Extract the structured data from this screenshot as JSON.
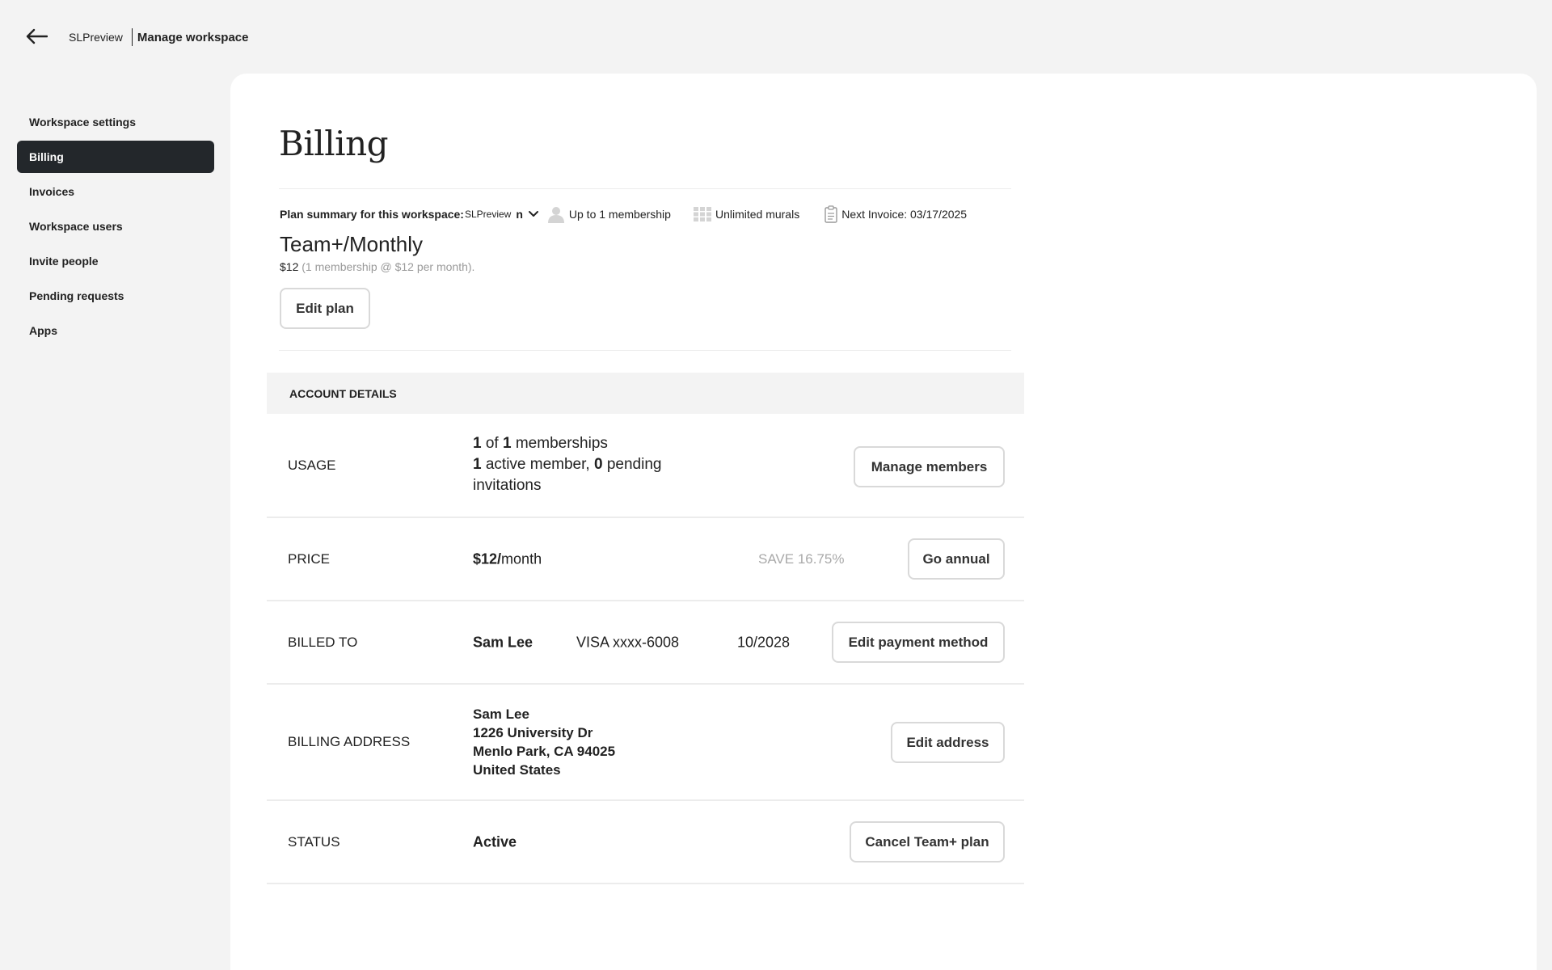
{
  "header": {
    "back_icon": "arrow-left-icon",
    "workspace_name": "SLPreview",
    "page_context": "Manage workspace"
  },
  "sidebar": {
    "items": [
      {
        "label": "Workspace settings",
        "active": false
      },
      {
        "label": "Billing",
        "active": true
      },
      {
        "label": "Invoices",
        "active": false
      },
      {
        "label": "Workspace users",
        "active": false
      },
      {
        "label": "Invite people",
        "active": false
      },
      {
        "label": "Pending requests",
        "active": false
      },
      {
        "label": "Apps",
        "active": false
      }
    ]
  },
  "billing": {
    "title": "Billing",
    "summary_label": "Plan summary for this workspace:",
    "summary_workspace": "SLPreview",
    "summary_suffix": "n",
    "members_limit": "Up to 1 membership",
    "murals": "Unlimited murals",
    "next_invoice": "Next Invoice: 03/17/2025",
    "plan_name": "Team+/Monthly",
    "plan_price": "$12",
    "plan_price_detail": "(1 membership @ $12 per month).",
    "edit_plan_label": "Edit plan"
  },
  "account_details": {
    "header": "ACCOUNT DETAILS",
    "usage": {
      "label": "USAGE",
      "memberships_used": "1",
      "memberships_of": "of",
      "memberships_total": "1",
      "memberships_word": "memberships",
      "active_count": "1",
      "active_word": "active member,",
      "pending_count": "0",
      "pending_word": "pending invitations",
      "button": "Manage members"
    },
    "price": {
      "label": "PRICE",
      "amount": "$12/",
      "period": "month",
      "save_text": "SAVE 16.75%",
      "button": "Go annual"
    },
    "billed_to": {
      "label": "BILLED TO",
      "name": "Sam Lee",
      "card": "VISA xxxx-6008",
      "expiry": "10/2028",
      "button": "Edit payment method"
    },
    "billing_address": {
      "label": "BILLING ADDRESS",
      "lines": [
        "Sam Lee",
        "1226 University Dr",
        "Menlo Park, CA 94025",
        "United States"
      ],
      "button": "Edit address"
    },
    "status": {
      "label": "STATUS",
      "value": "Active",
      "button": "Cancel Team+ plan"
    }
  }
}
